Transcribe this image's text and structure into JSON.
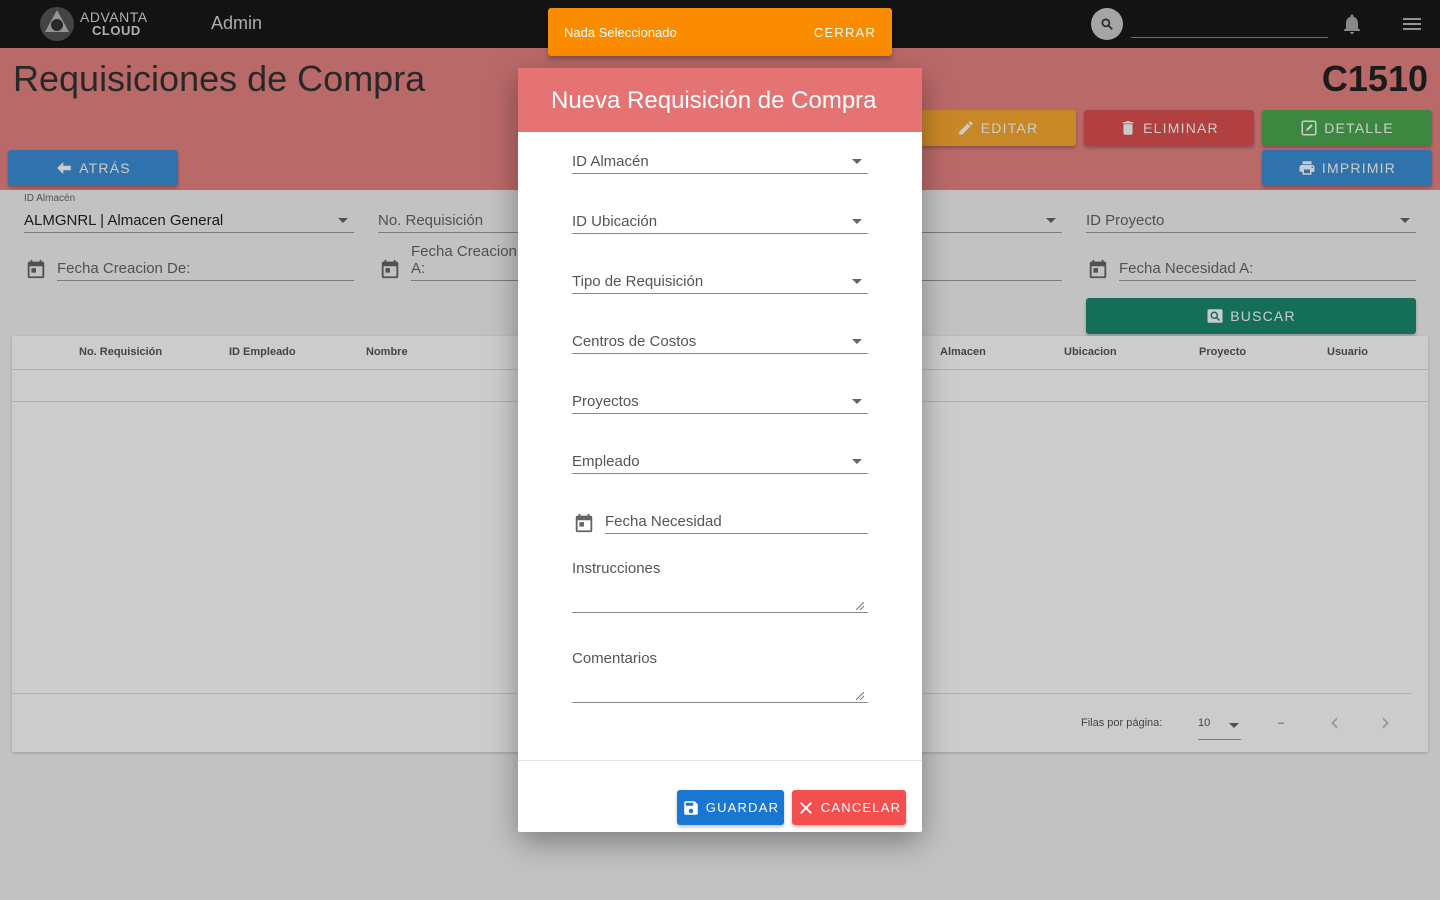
{
  "topbar": {
    "logo_line1": "ADVANTA",
    "logo_line2": "CLOUD",
    "title": "Admin",
    "search_placeholder": ""
  },
  "page": {
    "title": "Requisiciones de Compra",
    "code": "C1510"
  },
  "buttons": {
    "atras": "Atrás",
    "editar": "Editar",
    "eliminar": "Eliminar",
    "detalle": "Detalle",
    "imprimir": "Imprimir",
    "buscar": "Buscar"
  },
  "filters": {
    "almacen_label": "ID Almacén",
    "almacen_value": "ALMGNRL | Almacen General",
    "no_requisicion": "No. Requisición",
    "proyecto": "ID Proyecto",
    "fecha_creacion_de": "Fecha Creacion De:",
    "fecha_creacion_a": "Fecha Creacion A:",
    "fecha_necesidad_a": "Fecha Necesidad A:"
  },
  "table": {
    "headers": [
      "No. Requisición",
      "ID Empleado",
      "Nombre",
      "Almacen",
      "Ubicacion",
      "Proyecto",
      "Usuario"
    ],
    "rows_per_page_label": "Filas por página:",
    "rows_per_page_value": "10",
    "range": "–"
  },
  "toast": {
    "message": "Nada Seleccionado",
    "action": "Cerrar"
  },
  "dialog": {
    "title": "Nueva Requisición de Compra",
    "fields": {
      "almacen": "ID Almacén",
      "ubicacion": "ID Ubicación",
      "tipo": "Tipo de Requisición",
      "centros": "Centros de Costos",
      "proyectos": "Proyectos",
      "empleado": "Empleado",
      "fecha_necesidad": "Fecha Necesidad",
      "instrucciones": "Instrucciones",
      "comentarios": "Comentarios"
    },
    "guardar": "Guardar",
    "cancelar": "Cancelar"
  },
  "colors": {
    "topbar": "#181818",
    "header_band": "#e98484",
    "dialog_header": "#e57373",
    "toast": "#fb8c00",
    "primary": "#1976d2",
    "danger": "#f44f4f"
  }
}
